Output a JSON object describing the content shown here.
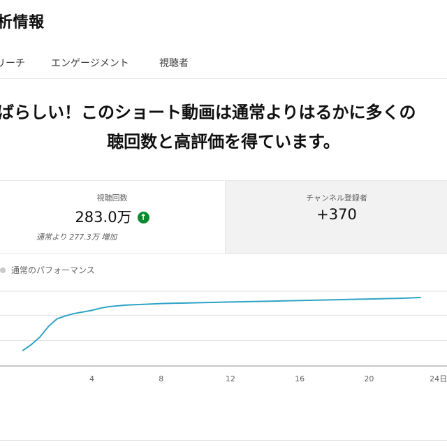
{
  "page": {
    "title": "析情報"
  },
  "tabs": [
    {
      "label": "リーチ"
    },
    {
      "label": "エンゲージメント"
    },
    {
      "label": "視聴者"
    }
  ],
  "headline": {
    "line1": "ばらしい！このショート動画は通常よりはるかに多くの",
    "line2": "聴回数と高評価を得ています。"
  },
  "metrics": {
    "views": {
      "label": "視聴回数",
      "value": "283.0万",
      "trend_icon": "arrow-up-icon",
      "comparison": "通常より 277.3万 増加"
    },
    "subscribers": {
      "label": "チャンネル登録者",
      "value": "+370"
    }
  },
  "legend": {
    "label": "通常のパフォーマンス"
  },
  "colors": {
    "line": "#2ea3c4",
    "trend_up": "#0a8a2e",
    "grid": "#e0e0e0"
  },
  "chart_data": {
    "type": "line",
    "x": [
      0,
      0.5,
      1,
      1.5,
      2,
      2.5,
      3,
      3.5,
      4,
      4.5,
      5,
      6,
      7,
      8,
      10,
      12,
      14,
      16,
      18,
      20,
      22,
      23
    ],
    "y": [
      0.2,
      0.28,
      0.38,
      0.52,
      0.62,
      0.66,
      0.69,
      0.71,
      0.73,
      0.76,
      0.78,
      0.8,
      0.81,
      0.82,
      0.83,
      0.84,
      0.85,
      0.86,
      0.87,
      0.88,
      0.89,
      0.9
    ],
    "xticks": [
      "4",
      "8",
      "12",
      "16",
      "20",
      "24日"
    ],
    "xtick_values": [
      4,
      8,
      12,
      16,
      20,
      24
    ],
    "xlim": [
      -1.3,
      24.5
    ],
    "ylim": [
      0,
      1
    ]
  }
}
